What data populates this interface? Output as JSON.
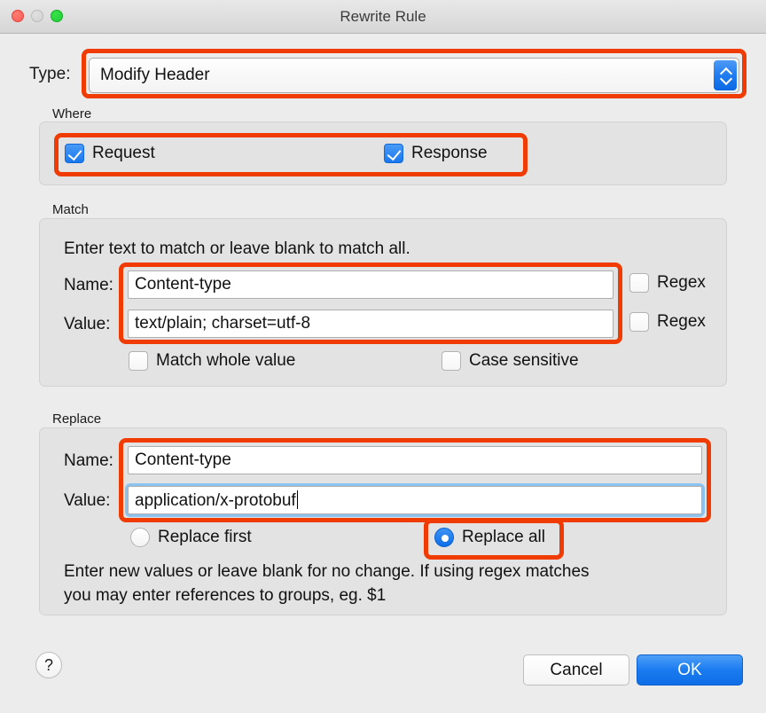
{
  "window": {
    "title": "Rewrite Rule",
    "traffic_lights": [
      "close-button",
      "minimize-button",
      "maximize-button"
    ]
  },
  "type_row": {
    "label": "Type:",
    "selected": "Modify Header",
    "options": [
      "Modify Header"
    ],
    "stepper_icon": "chevron-up-down-icon"
  },
  "where": {
    "title": "Where",
    "request": {
      "label": "Request",
      "checked": true
    },
    "response": {
      "label": "Response",
      "checked": true
    }
  },
  "match": {
    "title": "Match",
    "hint": "Enter text to match or leave blank to match all.",
    "name_label": "Name:",
    "name_value": "Content-type",
    "name_regex": {
      "label": "Regex",
      "checked": false
    },
    "value_label": "Value:",
    "value_value": "text/plain; charset=utf-8",
    "value_regex": {
      "label": "Regex",
      "checked": false
    },
    "match_whole_value": {
      "label": "Match whole value",
      "checked": false
    },
    "case_sensitive": {
      "label": "Case sensitive",
      "checked": false
    }
  },
  "replace": {
    "title": "Replace",
    "name_label": "Name:",
    "name_value": "Content-type",
    "value_label": "Value:",
    "value_value": "application/x-protobuf",
    "value_focused": true,
    "replace_first": {
      "label": "Replace first",
      "selected": false
    },
    "replace_all": {
      "label": "Replace all",
      "selected": true
    },
    "hint_line1": "Enter new values or leave blank for no change. If using regex matches",
    "hint_line2": "you may enter references to groups, eg. $1"
  },
  "footer": {
    "help_label": "?",
    "cancel_label": "Cancel",
    "ok_label": "OK"
  },
  "colors": {
    "annotation": "#f03c02",
    "accent_blue": "#1a7bf0",
    "focus_ring": "#8cc2f0",
    "window_bg": "#ececec",
    "group_bg": "#e3e3e3"
  }
}
